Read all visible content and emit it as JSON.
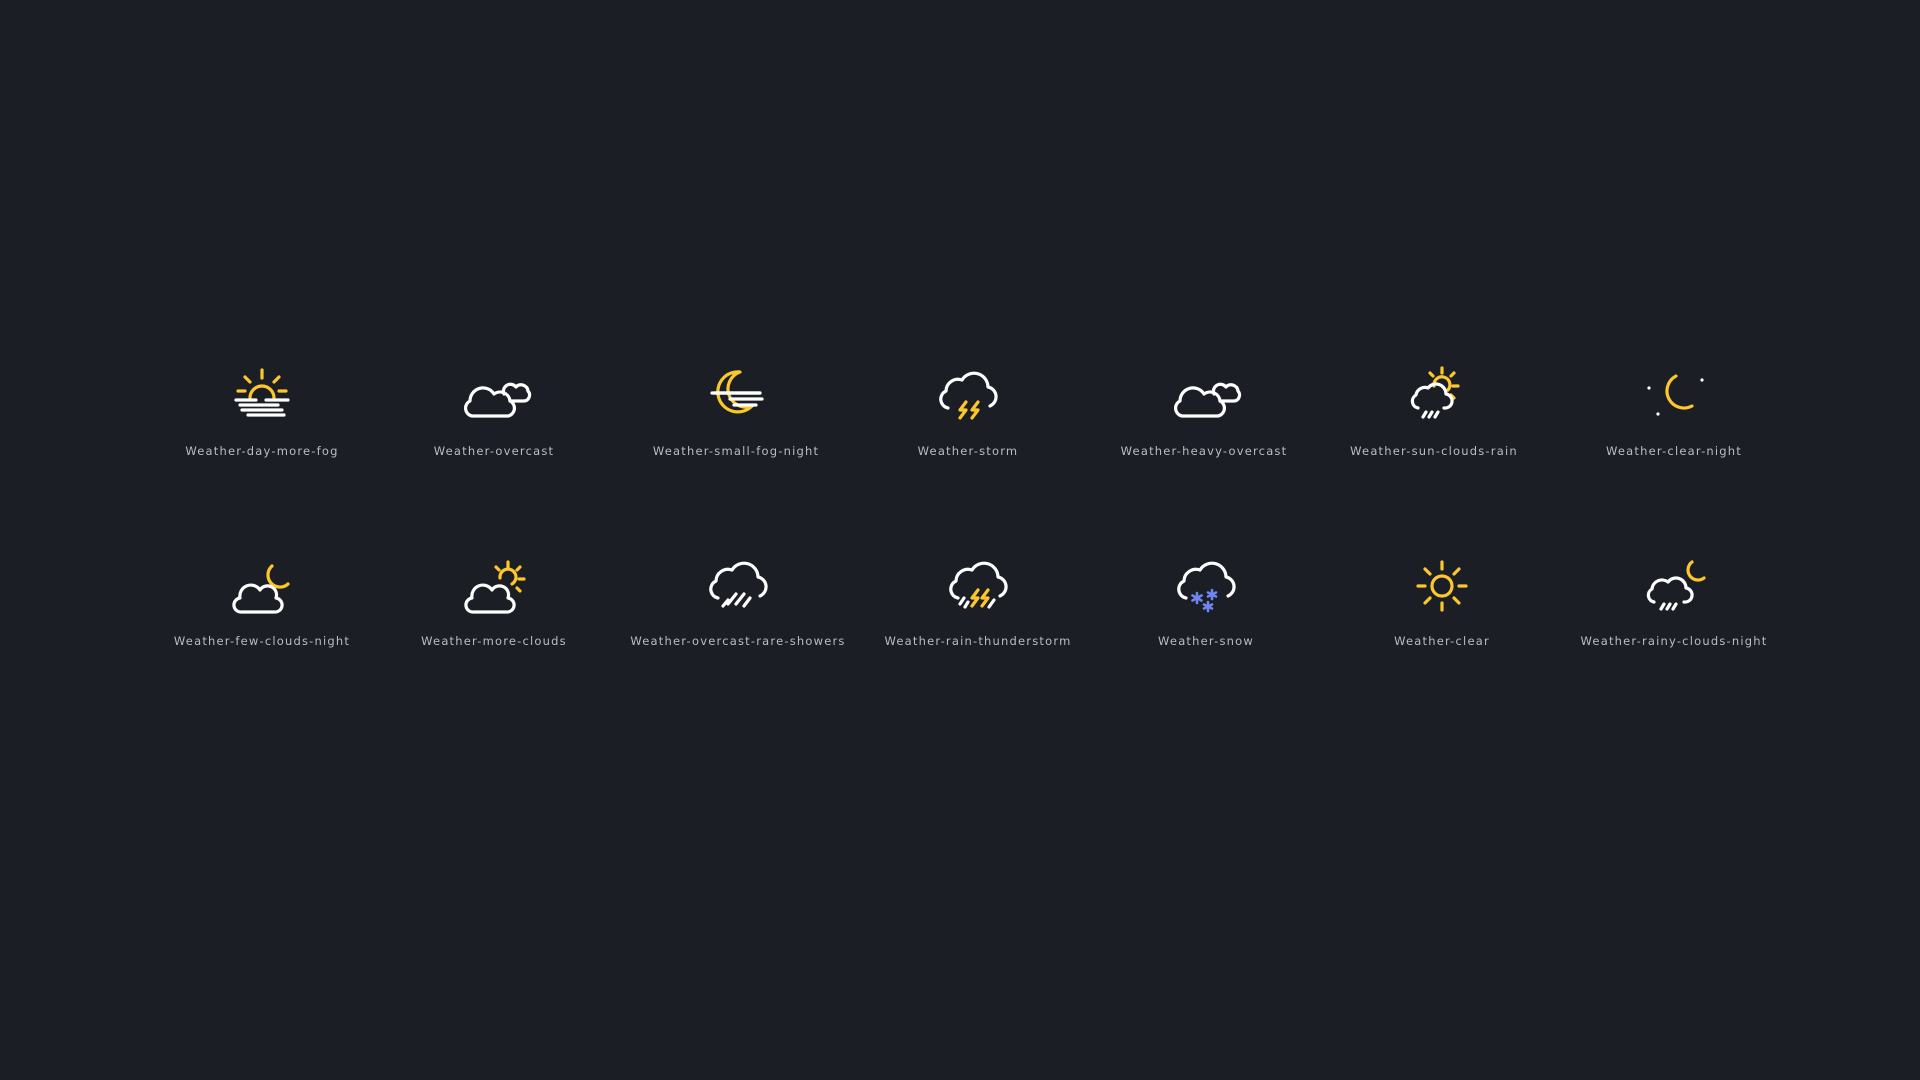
{
  "colors": {
    "background": "#1b1e24",
    "icon_white": "#ffffff",
    "icon_yellow": "#fcc72c",
    "icon_blue": "#6f86f2",
    "label": "#b9bdc4"
  },
  "rows": [
    {
      "items": [
        {
          "label": "Weather-day-more-fog",
          "icon": "day-more-fog-icon"
        },
        {
          "label": "Weather-overcast",
          "icon": "overcast-icon"
        },
        {
          "label": "Weather-small-fog-night",
          "icon": "small-fog-night-icon"
        },
        {
          "label": "Weather-storm",
          "icon": "storm-icon"
        },
        {
          "label": "Weather-heavy-overcast",
          "icon": "heavy-overcast-icon"
        },
        {
          "label": "Weather-sun-clouds-rain",
          "icon": "sun-clouds-rain-icon"
        },
        {
          "label": "Weather-clear-night",
          "icon": "clear-night-icon"
        }
      ]
    },
    {
      "items": [
        {
          "label": "Weather-few-clouds-night",
          "icon": "few-clouds-night-icon"
        },
        {
          "label": "Weather-more-clouds",
          "icon": "more-clouds-icon"
        },
        {
          "label": "Weather-overcast-rare-showers",
          "icon": "overcast-rare-showers-icon"
        },
        {
          "label": "Weather-rain-thunderstorm",
          "icon": "rain-thunderstorm-icon"
        },
        {
          "label": "Weather-snow",
          "icon": "snow-icon"
        },
        {
          "label": "Weather-clear",
          "icon": "clear-icon"
        },
        {
          "label": "Weather-rainy-clouds-night",
          "icon": "rainy-clouds-night-icon"
        }
      ]
    }
  ]
}
